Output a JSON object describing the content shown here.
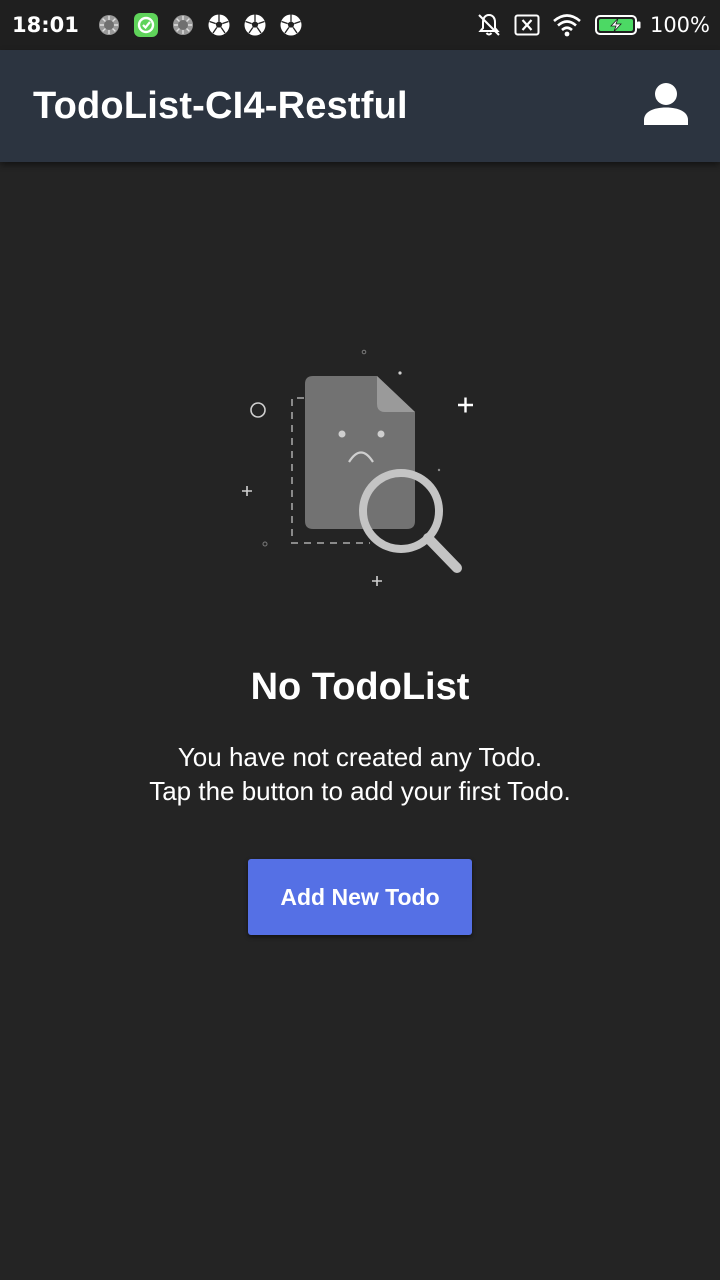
{
  "status_bar": {
    "time": "18:01",
    "battery_text": "100%",
    "left_icons": [
      "spinner-icon",
      "green-app-icon",
      "spinner-icon",
      "soccer-ball-icon",
      "soccer-ball-icon",
      "soccer-ball-icon"
    ],
    "right_icons": [
      "mute-bell-icon",
      "no-sim-icon",
      "wifi-icon",
      "battery-charging-icon"
    ]
  },
  "app_bar": {
    "title": "TodoList-CI4-Restful",
    "profile_icon": "account-icon"
  },
  "empty_state": {
    "illustration_icon": "empty-file-search-icon",
    "title": "No TodoList",
    "line1": "You have not created any Todo.",
    "line2": "Tap the button to add your first Todo.",
    "button_label": "Add New Todo"
  },
  "colors": {
    "background": "#242424",
    "status_bar": "#1f1f1f",
    "app_bar": "#2c3440",
    "accent": "#5570e5",
    "battery_green": "#4cd964"
  }
}
